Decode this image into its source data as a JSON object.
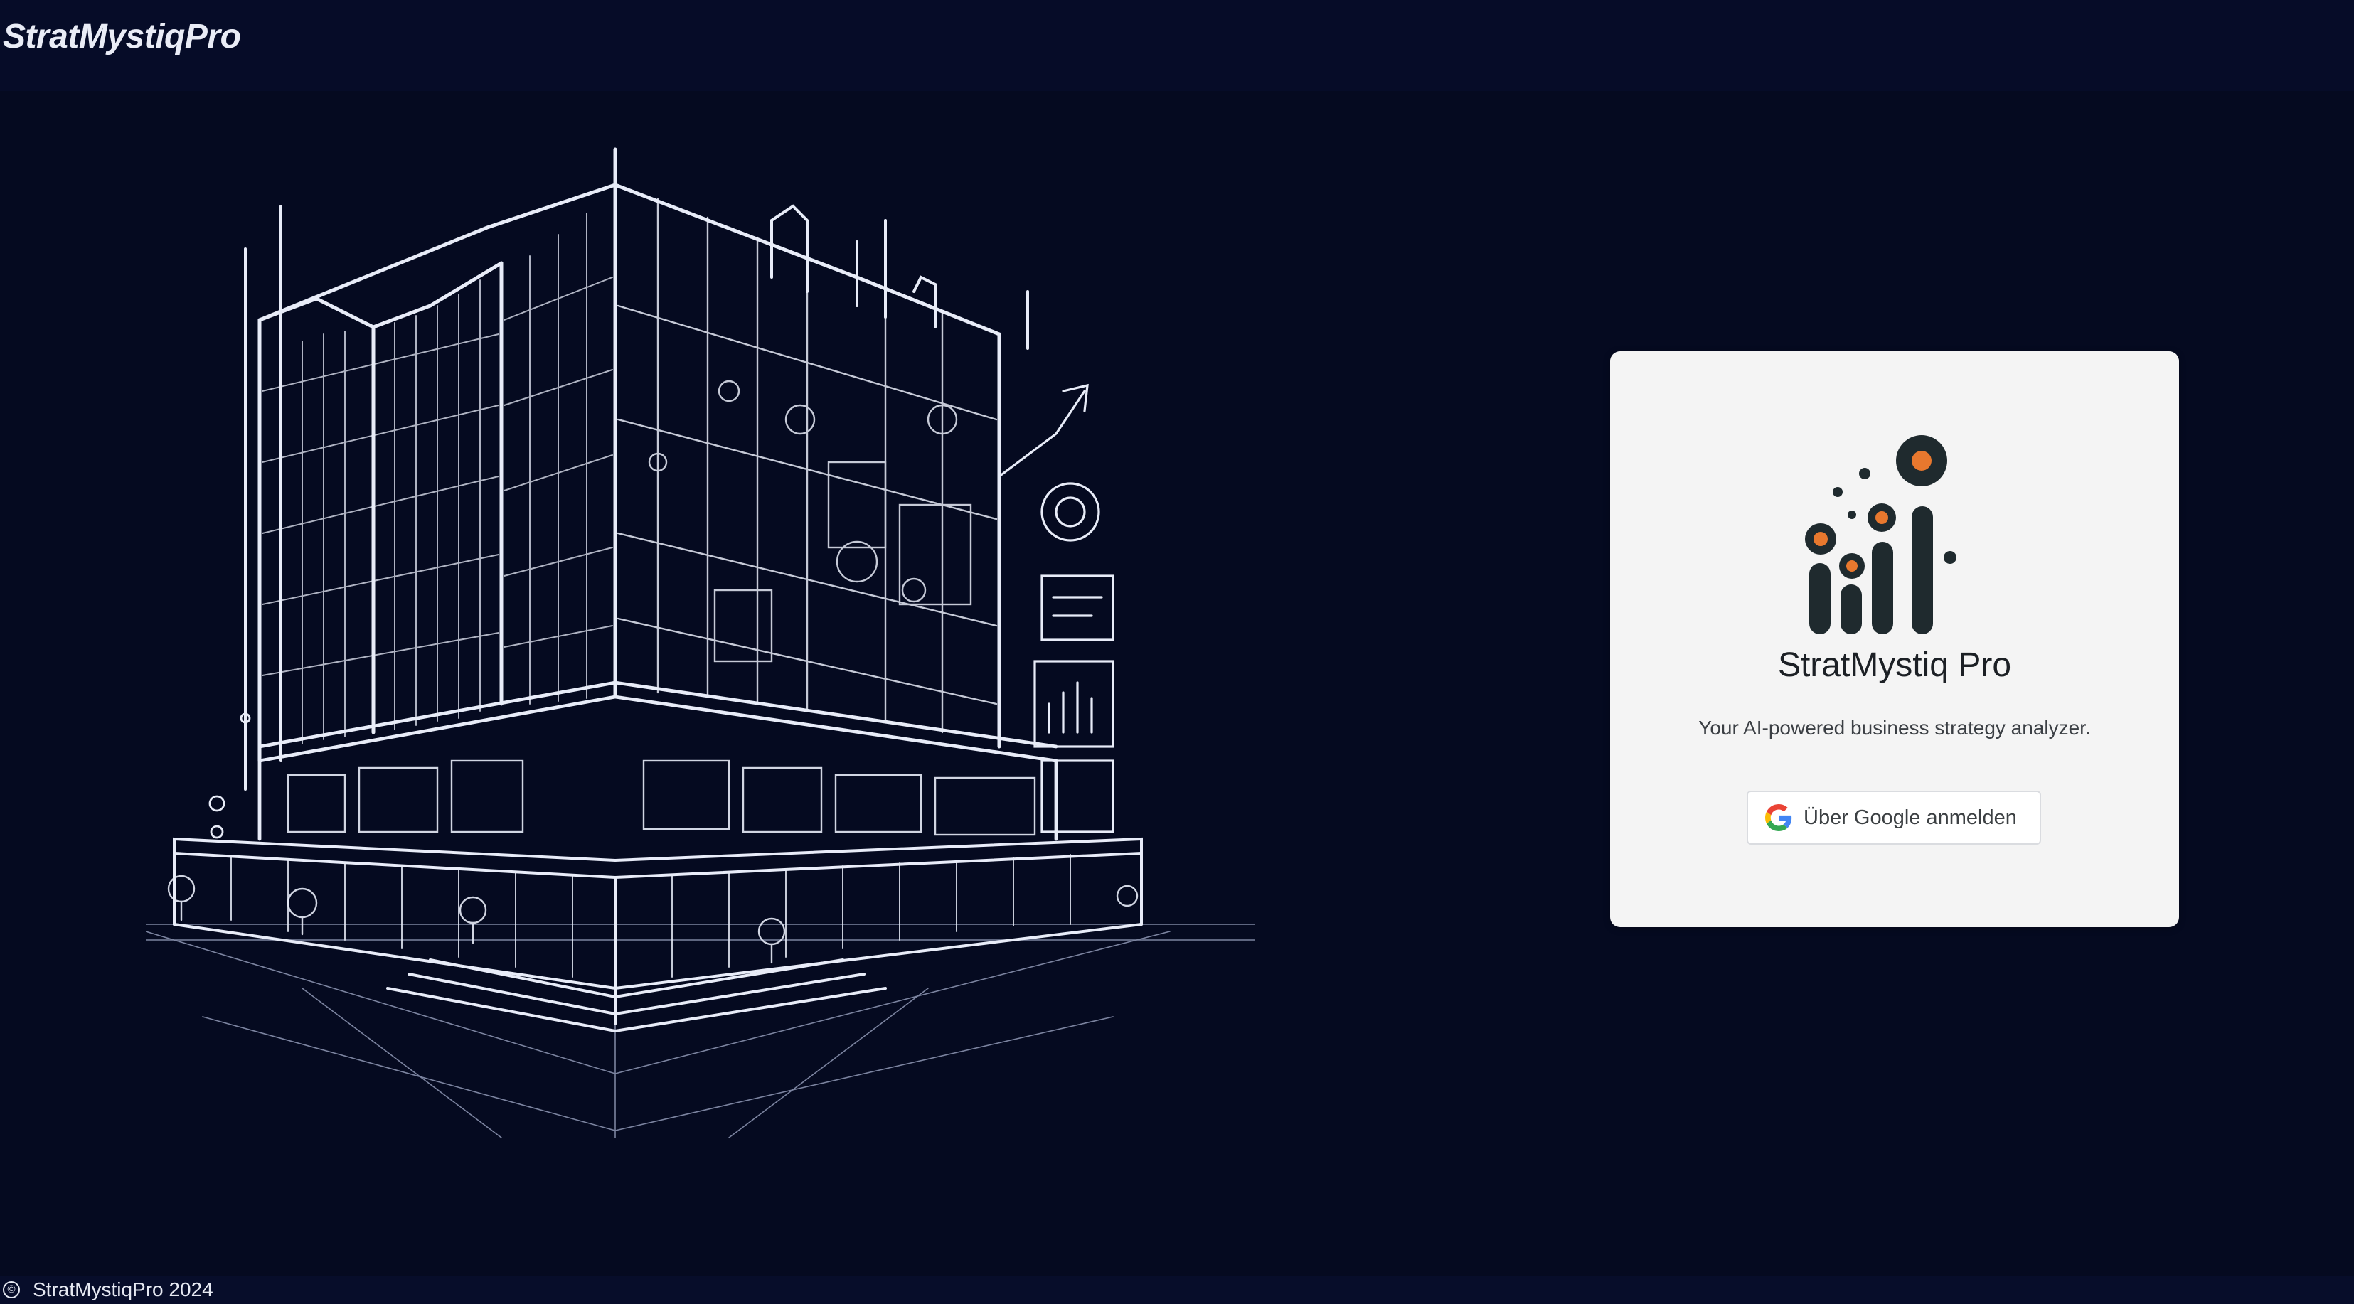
{
  "header": {
    "brand": "StratMystiqPro"
  },
  "hero": {
    "image": "building-line-illustration"
  },
  "login_card": {
    "logo": "chart-logo-icon",
    "title": "StratMystiq Pro",
    "subtitle": "Your AI-powered business strategy analyzer.",
    "google_button_label": "Über Google anmelden",
    "google_icon": "google-g-icon"
  },
  "footer": {
    "copyright_symbol": "©",
    "text": "StratMystiqPro 2024"
  },
  "colors": {
    "background": "#050a20",
    "topbar": "#060c28",
    "card": "#f4f4f4",
    "logo_dark": "#1f2a2e",
    "logo_accent": "#e8782e"
  }
}
